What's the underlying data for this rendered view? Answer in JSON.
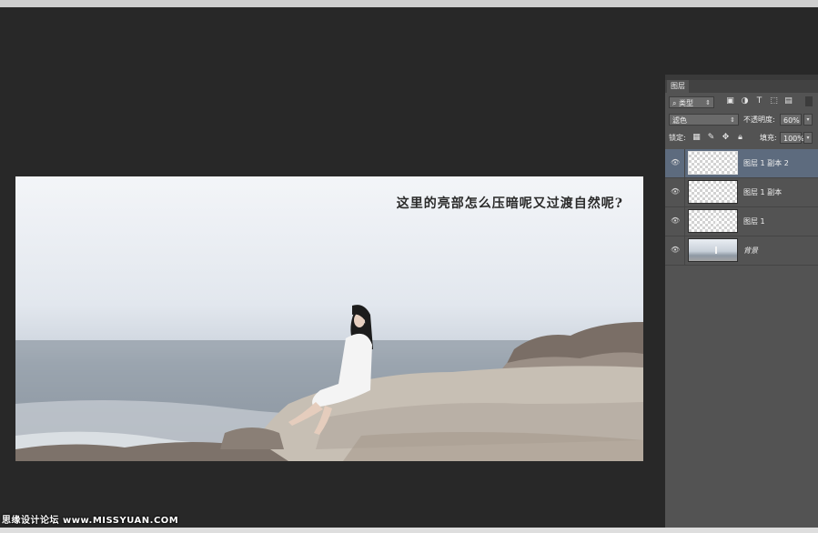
{
  "document": {
    "caption": "这里的亮部怎么压暗呢又过渡自然呢?"
  },
  "layers_panel": {
    "tab_label": "图层",
    "filter_type": "类型",
    "blend_mode": "滤色",
    "opacity_label": "不透明度:",
    "opacity_value": "60%",
    "lock_label": "锁定:",
    "fill_label": "填充:",
    "fill_value": "100%",
    "layers": [
      {
        "name": "图层 1 副本 2",
        "selected": true
      },
      {
        "name": "图层 1 副本",
        "selected": false
      },
      {
        "name": "图层 1",
        "selected": false
      },
      {
        "name": "背景",
        "selected": false
      }
    ]
  },
  "watermark": "思缘设计论坛 www.MISSYUAN.COM",
  "icons": {
    "filter": "search-icon",
    "eye": "visibility-eye-icon",
    "lock": "lock-icon"
  }
}
